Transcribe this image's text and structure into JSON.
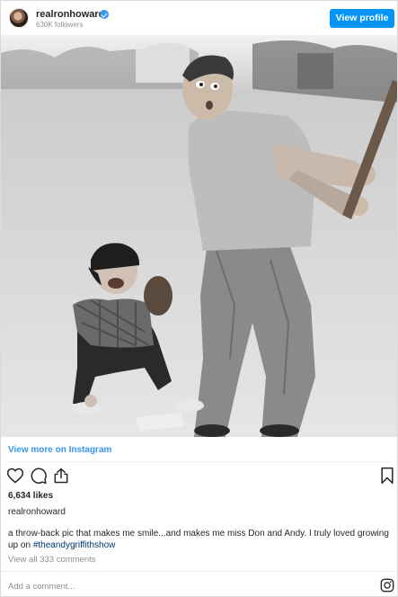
{
  "header": {
    "username": "realronhoward",
    "verified": true,
    "followers": "630K followers",
    "view_profile_label": "View profile"
  },
  "post": {
    "image_alt": "Black and white photo of a man swinging a baseball bat while a smiling boy catcher crouches behind him",
    "view_more_label": "View more on Instagram",
    "likes": "6,634 likes",
    "author": "realronhoward",
    "caption_text": "a throw-back pic that makes me smile...and makes me miss Don and Andy. I truly loved growing up on ",
    "caption_hashtag": "#theandygriffithshow",
    "view_comments_label": "View all 333 comments",
    "add_comment_placeholder": "Add a comment..."
  },
  "icons": {
    "like": "heart-icon",
    "comment": "comment-icon",
    "share": "share-icon",
    "save": "bookmark-icon",
    "brand": "instagram-icon"
  },
  "colors": {
    "accent": "#0095f6",
    "link": "#3897f0",
    "hashtag": "#00376b",
    "muted": "#8e8e8e"
  }
}
